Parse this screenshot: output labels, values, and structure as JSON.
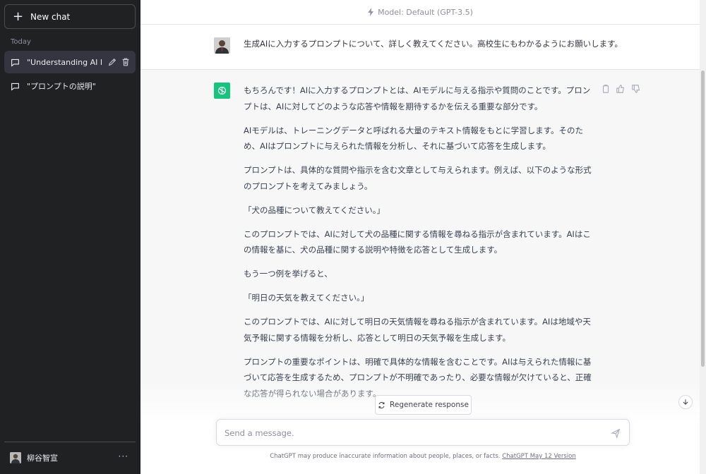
{
  "sidebar": {
    "new_chat_label": "New chat",
    "section_today": "Today",
    "conversations": [
      {
        "title": "\"Understanding AI Pro"
      },
      {
        "title": "\"プロンプトの説明\""
      }
    ],
    "user_name": "柳谷智宣",
    "more_label": "···"
  },
  "header": {
    "model_label": "Model: Default (GPT-3.5)"
  },
  "messages": {
    "user": "生成AIに入力するプロンプトについて、詳しく教えてください。高校生にもわかるようにお願いします。",
    "assistant": [
      "もちろんです！AIに入力するプロンプトとは、AIモデルに与える指示や質問のことです。プロンプトは、AIに対してどのような応答や情報を期待するかを伝える重要な部分です。",
      "AIモデルは、トレーニングデータと呼ばれる大量のテキスト情報をもとに学習します。そのため、AIはプロンプトに与えられた情報を分析し、それに基づいて応答を生成します。",
      "プロンプトは、具体的な質問や指示を含む文章として与えられます。例えば、以下のような形式のプロンプトを考えてみましょう。",
      "「犬の品種について教えてください。」",
      "このプロンプトでは、AIに対して犬の品種に関する情報を尋ねる指示が含まれています。AIはこの情報を基に、犬の品種に関する説明や特徴を応答として生成します。",
      "もう一つ例を挙げると、",
      "「明日の天気を教えてください。」",
      "このプロンプトでは、AIに対して明日の天気情報を尋ねる指示が含まれています。AIは地域や天気予報に関する情報を分析し、応答として明日の天気予報を生成します。",
      "プロンプトの重要なポイントは、明確で具体的な情報を含むことです。AIは与えられた情報に基づいて応答を生成するため、プロンプトが不明確であったり、必要な情報が欠けていると、正確な応答が得られない場合があります。"
    ]
  },
  "composer": {
    "regenerate_label": "Regenerate response",
    "placeholder": "Send a message."
  },
  "footer": {
    "disclaimer": "ChatGPT may produce inaccurate information about people, places, or facts. ",
    "version_link": "ChatGPT May 12 Version"
  },
  "colors": {
    "sidebar_bg": "#202123",
    "active_conv_bg": "#343541",
    "assistant_bg": "#f7f7f8",
    "brand_green": "#19c37d"
  }
}
